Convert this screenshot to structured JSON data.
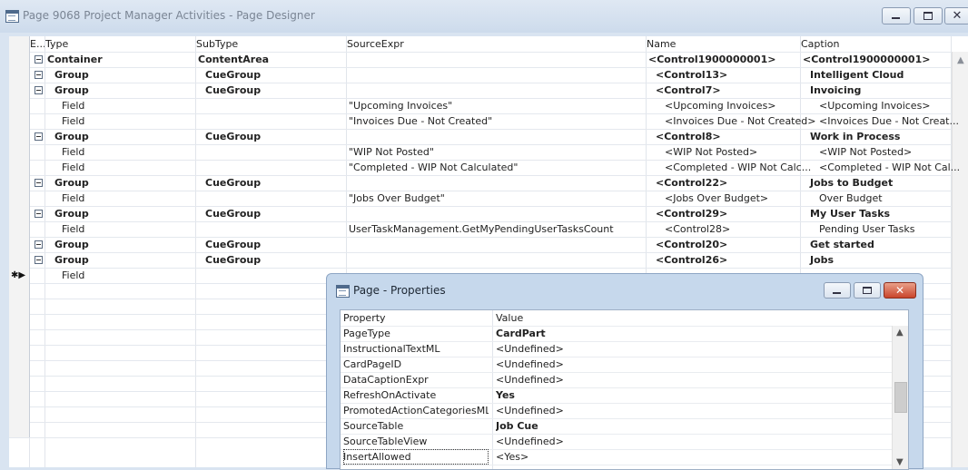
{
  "window": {
    "title": "Page 9068 Project Manager Activities - Page Designer"
  },
  "grid": {
    "columns": {
      "expand": "E...",
      "type": "Type",
      "subtype": "SubType",
      "source": "SourceExpr",
      "name": "Name",
      "caption": "Caption"
    },
    "rows": [
      {
        "exp": true,
        "type": "Container",
        "subtype": "ContentArea",
        "source": "",
        "name": "<Control1900000001>",
        "caption": "<Control1900000001>",
        "bold": true,
        "level": 0
      },
      {
        "exp": true,
        "type": "Group",
        "subtype": "CueGroup",
        "source": "",
        "name": "<Control13>",
        "caption": "Intelligent Cloud",
        "bold": true,
        "level": 1
      },
      {
        "exp": true,
        "type": "Group",
        "subtype": "CueGroup",
        "source": "",
        "name": "<Control7>",
        "caption": "Invoicing",
        "bold": true,
        "level": 1
      },
      {
        "exp": false,
        "type": "Field",
        "subtype": "",
        "source": "\"Upcoming Invoices\"",
        "name": "<Upcoming Invoices>",
        "caption": "<Upcoming Invoices>",
        "bold": false,
        "level": 2
      },
      {
        "exp": false,
        "type": "Field",
        "subtype": "",
        "source": "\"Invoices Due - Not Created\"",
        "name": "<Invoices Due - Not Created>",
        "caption": "<Invoices Due - Not Creat...",
        "bold": false,
        "level": 2
      },
      {
        "exp": true,
        "type": "Group",
        "subtype": "CueGroup",
        "source": "",
        "name": "<Control8>",
        "caption": "Work in Process",
        "bold": true,
        "level": 1
      },
      {
        "exp": false,
        "type": "Field",
        "subtype": "",
        "source": "\"WIP Not Posted\"",
        "name": "<WIP Not Posted>",
        "caption": "<WIP Not Posted>",
        "bold": false,
        "level": 2
      },
      {
        "exp": false,
        "type": "Field",
        "subtype": "",
        "source": "\"Completed - WIP Not Calculated\"",
        "name": "<Completed - WIP Not Calc...",
        "caption": "<Completed - WIP Not Cal...",
        "bold": false,
        "level": 2
      },
      {
        "exp": true,
        "type": "Group",
        "subtype": "CueGroup",
        "source": "",
        "name": "<Control22>",
        "caption": "Jobs to Budget",
        "bold": true,
        "level": 1
      },
      {
        "exp": false,
        "type": "Field",
        "subtype": "",
        "source": "\"Jobs Over Budget\"",
        "name": "<Jobs Over Budget>",
        "caption": "Over Budget",
        "bold": false,
        "level": 2
      },
      {
        "exp": true,
        "type": "Group",
        "subtype": "CueGroup",
        "source": "",
        "name": "<Control29>",
        "caption": "My User Tasks",
        "bold": true,
        "level": 1
      },
      {
        "exp": false,
        "type": "Field",
        "subtype": "",
        "source": "UserTaskManagement.GetMyPendingUserTasksCount",
        "name": "<Control28>",
        "caption": "Pending User Tasks",
        "bold": false,
        "level": 2
      },
      {
        "exp": true,
        "type": "Group",
        "subtype": "CueGroup",
        "source": "",
        "name": "<Control20>",
        "caption": "Get started",
        "bold": true,
        "level": 1
      },
      {
        "exp": true,
        "type": "Group",
        "subtype": "CueGroup",
        "source": "",
        "name": "<Control26>",
        "caption": "Jobs",
        "bold": true,
        "level": 1
      },
      {
        "exp": false,
        "type": "Field",
        "subtype": "",
        "source": "",
        "name": "",
        "caption": "",
        "bold": false,
        "level": 2,
        "new": true
      }
    ],
    "empty_rows": 10,
    "new_row_marker": "✱▶"
  },
  "dialog": {
    "title": "Page - Properties",
    "headers": {
      "property": "Property",
      "value": "Value"
    },
    "properties": [
      {
        "property": "PageType",
        "value": "CardPart",
        "bold": true
      },
      {
        "property": "InstructionalTextML",
        "value": "<Undefined>",
        "bold": false
      },
      {
        "property": "CardPageID",
        "value": "<Undefined>",
        "bold": false
      },
      {
        "property": "DataCaptionExpr",
        "value": "<Undefined>",
        "bold": false
      },
      {
        "property": "RefreshOnActivate",
        "value": "Yes",
        "bold": true
      },
      {
        "property": "PromotedActionCategoriesML",
        "value": "<Undefined>",
        "bold": false
      },
      {
        "property": "SourceTable",
        "value": "Job Cue",
        "bold": true
      },
      {
        "property": "SourceTableView",
        "value": "<Undefined>",
        "bold": false
      },
      {
        "property": "InsertAllowed",
        "value": "<Yes>",
        "bold": false,
        "selected": true
      }
    ]
  }
}
